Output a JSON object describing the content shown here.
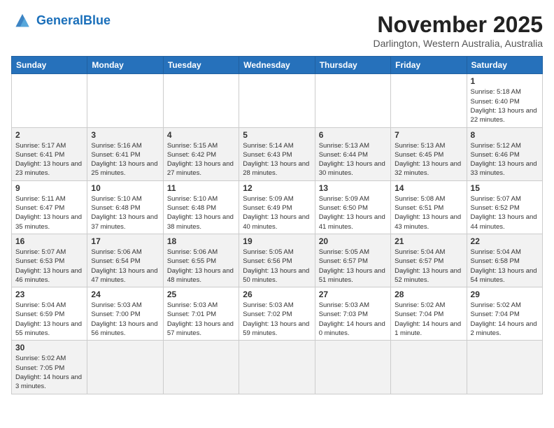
{
  "header": {
    "logo_general": "General",
    "logo_blue": "Blue",
    "month_title": "November 2025",
    "location": "Darlington, Western Australia, Australia"
  },
  "weekdays": [
    "Sunday",
    "Monday",
    "Tuesday",
    "Wednesday",
    "Thursday",
    "Friday",
    "Saturday"
  ],
  "weeks": [
    [
      {
        "day": "",
        "info": ""
      },
      {
        "day": "",
        "info": ""
      },
      {
        "day": "",
        "info": ""
      },
      {
        "day": "",
        "info": ""
      },
      {
        "day": "",
        "info": ""
      },
      {
        "day": "",
        "info": ""
      },
      {
        "day": "1",
        "info": "Sunrise: 5:18 AM\nSunset: 6:40 PM\nDaylight: 13 hours and 22 minutes."
      }
    ],
    [
      {
        "day": "2",
        "info": "Sunrise: 5:17 AM\nSunset: 6:41 PM\nDaylight: 13 hours and 23 minutes."
      },
      {
        "day": "3",
        "info": "Sunrise: 5:16 AM\nSunset: 6:41 PM\nDaylight: 13 hours and 25 minutes."
      },
      {
        "day": "4",
        "info": "Sunrise: 5:15 AM\nSunset: 6:42 PM\nDaylight: 13 hours and 27 minutes."
      },
      {
        "day": "5",
        "info": "Sunrise: 5:14 AM\nSunset: 6:43 PM\nDaylight: 13 hours and 28 minutes."
      },
      {
        "day": "6",
        "info": "Sunrise: 5:13 AM\nSunset: 6:44 PM\nDaylight: 13 hours and 30 minutes."
      },
      {
        "day": "7",
        "info": "Sunrise: 5:13 AM\nSunset: 6:45 PM\nDaylight: 13 hours and 32 minutes."
      },
      {
        "day": "8",
        "info": "Sunrise: 5:12 AM\nSunset: 6:46 PM\nDaylight: 13 hours and 33 minutes."
      }
    ],
    [
      {
        "day": "9",
        "info": "Sunrise: 5:11 AM\nSunset: 6:47 PM\nDaylight: 13 hours and 35 minutes."
      },
      {
        "day": "10",
        "info": "Sunrise: 5:10 AM\nSunset: 6:48 PM\nDaylight: 13 hours and 37 minutes."
      },
      {
        "day": "11",
        "info": "Sunrise: 5:10 AM\nSunset: 6:48 PM\nDaylight: 13 hours and 38 minutes."
      },
      {
        "day": "12",
        "info": "Sunrise: 5:09 AM\nSunset: 6:49 PM\nDaylight: 13 hours and 40 minutes."
      },
      {
        "day": "13",
        "info": "Sunrise: 5:09 AM\nSunset: 6:50 PM\nDaylight: 13 hours and 41 minutes."
      },
      {
        "day": "14",
        "info": "Sunrise: 5:08 AM\nSunset: 6:51 PM\nDaylight: 13 hours and 43 minutes."
      },
      {
        "day": "15",
        "info": "Sunrise: 5:07 AM\nSunset: 6:52 PM\nDaylight: 13 hours and 44 minutes."
      }
    ],
    [
      {
        "day": "16",
        "info": "Sunrise: 5:07 AM\nSunset: 6:53 PM\nDaylight: 13 hours and 46 minutes."
      },
      {
        "day": "17",
        "info": "Sunrise: 5:06 AM\nSunset: 6:54 PM\nDaylight: 13 hours and 47 minutes."
      },
      {
        "day": "18",
        "info": "Sunrise: 5:06 AM\nSunset: 6:55 PM\nDaylight: 13 hours and 48 minutes."
      },
      {
        "day": "19",
        "info": "Sunrise: 5:05 AM\nSunset: 6:56 PM\nDaylight: 13 hours and 50 minutes."
      },
      {
        "day": "20",
        "info": "Sunrise: 5:05 AM\nSunset: 6:57 PM\nDaylight: 13 hours and 51 minutes."
      },
      {
        "day": "21",
        "info": "Sunrise: 5:04 AM\nSunset: 6:57 PM\nDaylight: 13 hours and 52 minutes."
      },
      {
        "day": "22",
        "info": "Sunrise: 5:04 AM\nSunset: 6:58 PM\nDaylight: 13 hours and 54 minutes."
      }
    ],
    [
      {
        "day": "23",
        "info": "Sunrise: 5:04 AM\nSunset: 6:59 PM\nDaylight: 13 hours and 55 minutes."
      },
      {
        "day": "24",
        "info": "Sunrise: 5:03 AM\nSunset: 7:00 PM\nDaylight: 13 hours and 56 minutes."
      },
      {
        "day": "25",
        "info": "Sunrise: 5:03 AM\nSunset: 7:01 PM\nDaylight: 13 hours and 57 minutes."
      },
      {
        "day": "26",
        "info": "Sunrise: 5:03 AM\nSunset: 7:02 PM\nDaylight: 13 hours and 59 minutes."
      },
      {
        "day": "27",
        "info": "Sunrise: 5:03 AM\nSunset: 7:03 PM\nDaylight: 14 hours and 0 minutes."
      },
      {
        "day": "28",
        "info": "Sunrise: 5:02 AM\nSunset: 7:04 PM\nDaylight: 14 hours and 1 minute."
      },
      {
        "day": "29",
        "info": "Sunrise: 5:02 AM\nSunset: 7:04 PM\nDaylight: 14 hours and 2 minutes."
      }
    ],
    [
      {
        "day": "30",
        "info": "Sunrise: 5:02 AM\nSunset: 7:05 PM\nDaylight: 14 hours and 3 minutes."
      },
      {
        "day": "",
        "info": ""
      },
      {
        "day": "",
        "info": ""
      },
      {
        "day": "",
        "info": ""
      },
      {
        "day": "",
        "info": ""
      },
      {
        "day": "",
        "info": ""
      },
      {
        "day": "",
        "info": ""
      }
    ]
  ]
}
